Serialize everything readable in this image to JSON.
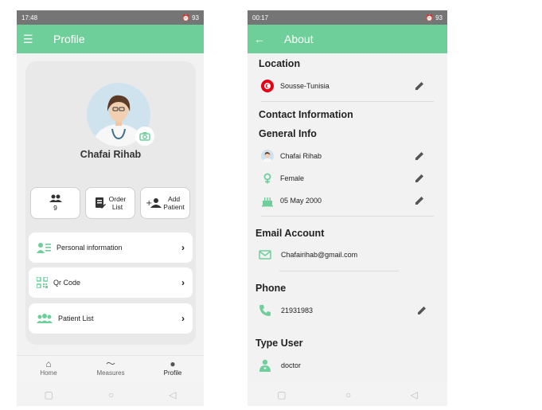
{
  "left": {
    "status": {
      "time": "17:48",
      "right": "⏰ 93"
    },
    "appbar": {
      "title": "Profile"
    },
    "profile": {
      "name": "Chafai Rihab"
    },
    "stats": [
      {
        "value": "9"
      },
      {
        "label1": "Order",
        "label2": "List"
      },
      {
        "label1": "Add",
        "label2": "Patient"
      }
    ],
    "menu": [
      {
        "label": "Personal information"
      },
      {
        "label": "Qr Code"
      },
      {
        "label": "Patient List"
      }
    ],
    "nav": [
      {
        "label": "Home"
      },
      {
        "label": "Measures"
      },
      {
        "label": "Profile"
      }
    ]
  },
  "right": {
    "status": {
      "time": "00:17",
      "right": "⏰ 93"
    },
    "appbar": {
      "title": "About"
    },
    "location": {
      "heading": "Location",
      "value": "Sousse-Tunisia"
    },
    "contact": {
      "heading": "Contact Information"
    },
    "general": {
      "heading": "General Info",
      "name": "Chafai Rihab",
      "gender": "Female",
      "birthday": "05 May 2000"
    },
    "email": {
      "heading": "Email Account",
      "value": "Chafairihab@gmail.com"
    },
    "phone": {
      "heading": "Phone",
      "value": "21931983"
    },
    "type": {
      "heading": "Type User",
      "value": "doctor"
    }
  },
  "colors": {
    "accent": "#6fcf9b",
    "statusbar": "#757575",
    "tunisia": "#e70013"
  }
}
